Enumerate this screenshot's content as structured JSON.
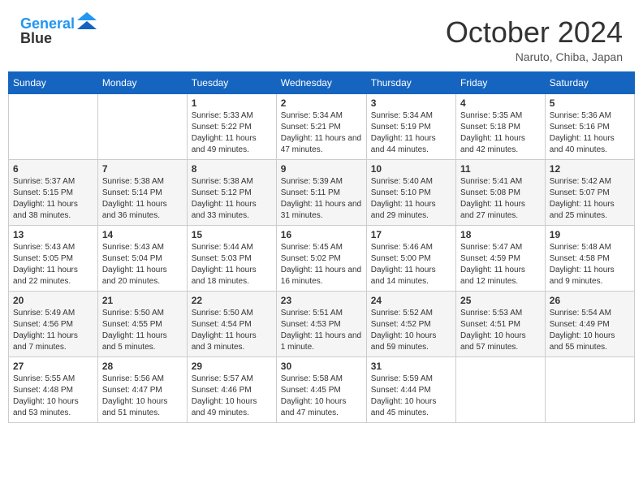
{
  "header": {
    "logo_line1": "General",
    "logo_line2": "Blue",
    "month": "October 2024",
    "location": "Naruto, Chiba, Japan"
  },
  "weekdays": [
    "Sunday",
    "Monday",
    "Tuesday",
    "Wednesday",
    "Thursday",
    "Friday",
    "Saturday"
  ],
  "weeks": [
    [
      {
        "day": "",
        "info": ""
      },
      {
        "day": "",
        "info": ""
      },
      {
        "day": "1",
        "info": "Sunrise: 5:33 AM\nSunset: 5:22 PM\nDaylight: 11 hours and 49 minutes."
      },
      {
        "day": "2",
        "info": "Sunrise: 5:34 AM\nSunset: 5:21 PM\nDaylight: 11 hours and 47 minutes."
      },
      {
        "day": "3",
        "info": "Sunrise: 5:34 AM\nSunset: 5:19 PM\nDaylight: 11 hours and 44 minutes."
      },
      {
        "day": "4",
        "info": "Sunrise: 5:35 AM\nSunset: 5:18 PM\nDaylight: 11 hours and 42 minutes."
      },
      {
        "day": "5",
        "info": "Sunrise: 5:36 AM\nSunset: 5:16 PM\nDaylight: 11 hours and 40 minutes."
      }
    ],
    [
      {
        "day": "6",
        "info": "Sunrise: 5:37 AM\nSunset: 5:15 PM\nDaylight: 11 hours and 38 minutes."
      },
      {
        "day": "7",
        "info": "Sunrise: 5:38 AM\nSunset: 5:14 PM\nDaylight: 11 hours and 36 minutes."
      },
      {
        "day": "8",
        "info": "Sunrise: 5:38 AM\nSunset: 5:12 PM\nDaylight: 11 hours and 33 minutes."
      },
      {
        "day": "9",
        "info": "Sunrise: 5:39 AM\nSunset: 5:11 PM\nDaylight: 11 hours and 31 minutes."
      },
      {
        "day": "10",
        "info": "Sunrise: 5:40 AM\nSunset: 5:10 PM\nDaylight: 11 hours and 29 minutes."
      },
      {
        "day": "11",
        "info": "Sunrise: 5:41 AM\nSunset: 5:08 PM\nDaylight: 11 hours and 27 minutes."
      },
      {
        "day": "12",
        "info": "Sunrise: 5:42 AM\nSunset: 5:07 PM\nDaylight: 11 hours and 25 minutes."
      }
    ],
    [
      {
        "day": "13",
        "info": "Sunrise: 5:43 AM\nSunset: 5:05 PM\nDaylight: 11 hours and 22 minutes."
      },
      {
        "day": "14",
        "info": "Sunrise: 5:43 AM\nSunset: 5:04 PM\nDaylight: 11 hours and 20 minutes."
      },
      {
        "day": "15",
        "info": "Sunrise: 5:44 AM\nSunset: 5:03 PM\nDaylight: 11 hours and 18 minutes."
      },
      {
        "day": "16",
        "info": "Sunrise: 5:45 AM\nSunset: 5:02 PM\nDaylight: 11 hours and 16 minutes."
      },
      {
        "day": "17",
        "info": "Sunrise: 5:46 AM\nSunset: 5:00 PM\nDaylight: 11 hours and 14 minutes."
      },
      {
        "day": "18",
        "info": "Sunrise: 5:47 AM\nSunset: 4:59 PM\nDaylight: 11 hours and 12 minutes."
      },
      {
        "day": "19",
        "info": "Sunrise: 5:48 AM\nSunset: 4:58 PM\nDaylight: 11 hours and 9 minutes."
      }
    ],
    [
      {
        "day": "20",
        "info": "Sunrise: 5:49 AM\nSunset: 4:56 PM\nDaylight: 11 hours and 7 minutes."
      },
      {
        "day": "21",
        "info": "Sunrise: 5:50 AM\nSunset: 4:55 PM\nDaylight: 11 hours and 5 minutes."
      },
      {
        "day": "22",
        "info": "Sunrise: 5:50 AM\nSunset: 4:54 PM\nDaylight: 11 hours and 3 minutes."
      },
      {
        "day": "23",
        "info": "Sunrise: 5:51 AM\nSunset: 4:53 PM\nDaylight: 11 hours and 1 minute."
      },
      {
        "day": "24",
        "info": "Sunrise: 5:52 AM\nSunset: 4:52 PM\nDaylight: 10 hours and 59 minutes."
      },
      {
        "day": "25",
        "info": "Sunrise: 5:53 AM\nSunset: 4:51 PM\nDaylight: 10 hours and 57 minutes."
      },
      {
        "day": "26",
        "info": "Sunrise: 5:54 AM\nSunset: 4:49 PM\nDaylight: 10 hours and 55 minutes."
      }
    ],
    [
      {
        "day": "27",
        "info": "Sunrise: 5:55 AM\nSunset: 4:48 PM\nDaylight: 10 hours and 53 minutes."
      },
      {
        "day": "28",
        "info": "Sunrise: 5:56 AM\nSunset: 4:47 PM\nDaylight: 10 hours and 51 minutes."
      },
      {
        "day": "29",
        "info": "Sunrise: 5:57 AM\nSunset: 4:46 PM\nDaylight: 10 hours and 49 minutes."
      },
      {
        "day": "30",
        "info": "Sunrise: 5:58 AM\nSunset: 4:45 PM\nDaylight: 10 hours and 47 minutes."
      },
      {
        "day": "31",
        "info": "Sunrise: 5:59 AM\nSunset: 4:44 PM\nDaylight: 10 hours and 45 minutes."
      },
      {
        "day": "",
        "info": ""
      },
      {
        "day": "",
        "info": ""
      }
    ]
  ]
}
